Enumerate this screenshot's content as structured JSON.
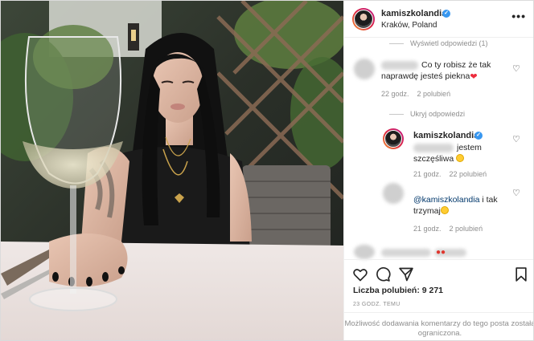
{
  "post": {
    "username": "kamiszkolandia",
    "location": "Kraków, Poland",
    "more_label": "•••",
    "view_replies_label": "Wyświetl odpowiedzi (1)",
    "hide_replies_label": "Ukryj odpowiedzi",
    "likes_label": "Liczba polubień: 9 271",
    "time_label": "23 GODZ. TEMU",
    "restricted_text": "Możliwość dodawania komentarzy do tego posta została ograniczona."
  },
  "comments": [
    {
      "text_line1": "Co ty robisz że tak",
      "text_line2": "naprawdę jesteś piekna",
      "time": "22 godz.",
      "likes": "2 polubień"
    },
    {
      "username": "kamiszkolandia",
      "text_line1": "jestem",
      "text_line2": "szczęśliwa",
      "time": "21 godz.",
      "likes": "22 polubień"
    },
    {
      "mention": "@kamiszkolandia",
      "text_line1": " i tak",
      "text_line2": "trzymaj",
      "time": "21 godz.",
      "likes": "2 polubień"
    }
  ],
  "icons": {
    "verified": "verified-badge-icon",
    "like": "heart-icon",
    "comment": "comment-icon",
    "share": "paper-plane-icon",
    "save": "bookmark-icon"
  },
  "colors": {
    "verified": "#3897f0",
    "heart": "#ed2c3d",
    "muted": "#8e8e8e",
    "text": "#262626"
  }
}
